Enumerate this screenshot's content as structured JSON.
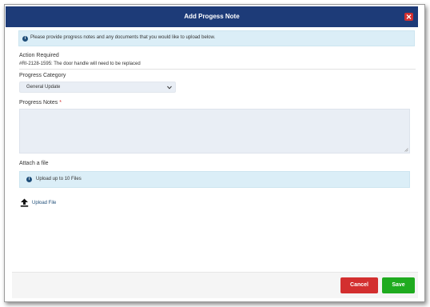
{
  "dialog": {
    "title": "Add Progess Note",
    "close_icon": "close-icon"
  },
  "info_banner": {
    "icon": "info-icon",
    "text": "Please provide progress notes and any documents that you would like to upload below."
  },
  "action_required": {
    "label": "Action Required",
    "value": "#RI-2128-1595: The door handle will need to be replaced"
  },
  "progress_category": {
    "label": "Progress Category",
    "selected": "General Update"
  },
  "progress_notes": {
    "label": "Progress Notes",
    "required_marker": "*",
    "value": ""
  },
  "attach": {
    "label": "Attach a file",
    "banner_icon": "info-icon",
    "banner_text": "Upload up to 10 Files",
    "upload_icon": "upload-icon",
    "upload_label": "Upload File"
  },
  "footer": {
    "cancel_label": "Cancel",
    "save_label": "Save"
  },
  "colors": {
    "titlebar": "#1d3b78",
    "info_bg": "#dbeef7",
    "cancel": "#d32f2f",
    "save": "#1fab1f"
  }
}
